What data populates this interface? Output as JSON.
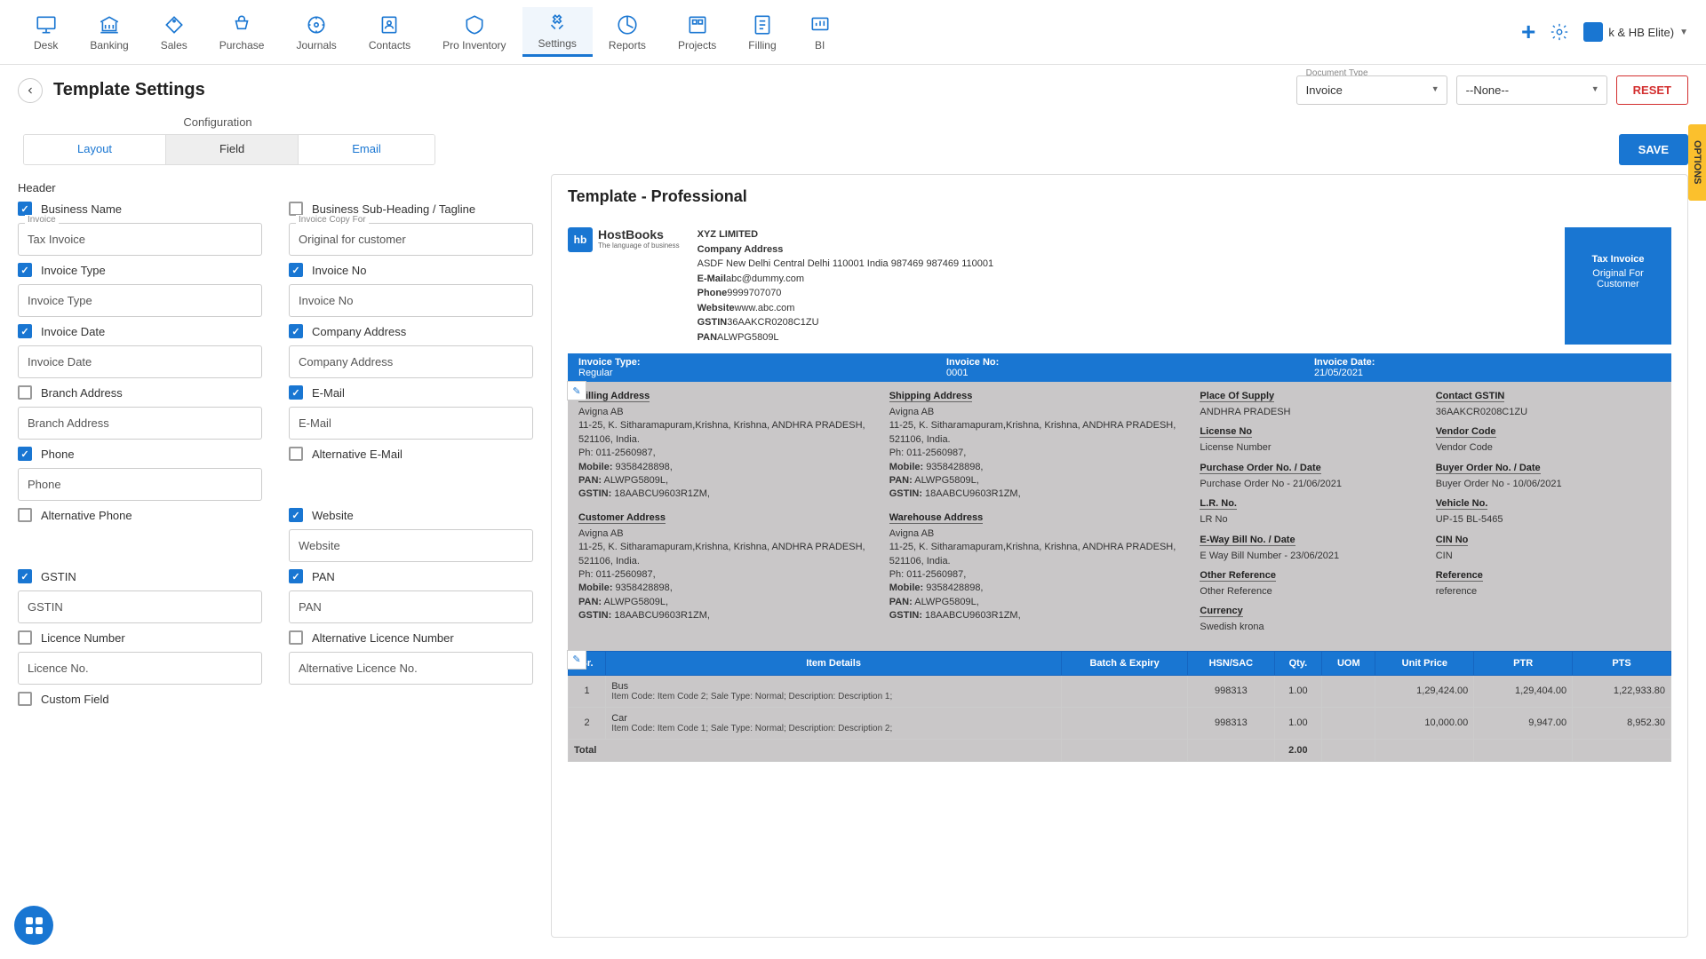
{
  "nav": [
    {
      "label": "Desk"
    },
    {
      "label": "Banking"
    },
    {
      "label": "Sales"
    },
    {
      "label": "Purchase"
    },
    {
      "label": "Journals"
    },
    {
      "label": "Contacts"
    },
    {
      "label": "Pro Inventory"
    },
    {
      "label": "Settings",
      "active": true
    },
    {
      "label": "Reports"
    },
    {
      "label": "Projects"
    },
    {
      "label": "Filling"
    },
    {
      "label": "BI"
    }
  ],
  "company": "k & HB Elite)",
  "pageTitle": "Template Settings",
  "docType": {
    "label": "Document Type",
    "value": "Invoice"
  },
  "secondSelect": "--None--",
  "resetBtn": "RESET",
  "saveBtn": "SAVE",
  "configLabel": "Configuration",
  "tabs": [
    "Layout",
    "Field",
    "Email"
  ],
  "optionsTab": "OPTIONS",
  "sectionHeader": "Header",
  "fields": [
    {
      "check": true,
      "label": "Business Name",
      "floatLabel": "Invoice",
      "value": "Tax Invoice"
    },
    {
      "check": false,
      "label": "Business Sub-Heading / Tagline",
      "floatLabel": "Invoice Copy For",
      "value": "Original for customer"
    },
    {
      "check": true,
      "label": "Invoice Type",
      "value": "Invoice Type"
    },
    {
      "check": true,
      "label": "Invoice No",
      "value": "Invoice No"
    },
    {
      "check": true,
      "label": "Invoice Date",
      "value": "Invoice Date"
    },
    {
      "check": true,
      "label": "Company Address",
      "value": "Company Address"
    },
    {
      "check": false,
      "label": "Branch Address",
      "value": "Branch Address"
    },
    {
      "check": true,
      "label": "E-Mail",
      "value": "E-Mail"
    },
    {
      "check": true,
      "label": "Phone",
      "value": "Phone"
    },
    {
      "check": false,
      "label": "Alternative E-Mail",
      "noInput": true
    },
    {
      "check": false,
      "label": "Alternative Phone",
      "noInput": true
    },
    {
      "check": true,
      "label": "Website",
      "value": "Website"
    },
    {
      "check": true,
      "label": "GSTIN",
      "value": "GSTIN"
    },
    {
      "check": true,
      "label": "PAN",
      "value": "PAN"
    },
    {
      "check": false,
      "label": "Licence Number",
      "value": "Licence No."
    },
    {
      "check": false,
      "label": "Alternative Licence Number",
      "value": "Alternative Licence No."
    },
    {
      "check": false,
      "label": "Custom Field",
      "noInput": true
    }
  ],
  "preview": {
    "title": "Template - Professional",
    "logo": {
      "name": "HostBooks",
      "sub": "The language of business"
    },
    "company": {
      "name": "XYZ LIMITED",
      "addrLabel": "Company Address",
      "addr": "ASDF New Delhi Central Delhi 110001 India 987469 987469 110001",
      "emailLabel": "E-Mail",
      "email": "abc@dummy.com",
      "phoneLabel": "Phone",
      "phone": "9999707070",
      "webLabel": "Website",
      "web": "www.abc.com",
      "gstinLabel": "GSTIN",
      "gstin": "36AAKCR0208C1ZU",
      "panLabel": "PAN",
      "pan": "ALWPG5809L"
    },
    "blueBox": {
      "title": "Tax Invoice",
      "sub": "Original For Customer"
    },
    "bar": {
      "c1l": "Invoice Type:",
      "c1v": "Regular",
      "c2l": "Invoice No:",
      "c2v": "0001",
      "c3l": "Invoice Date:",
      "c3v": "21/05/2021"
    },
    "addr": {
      "billing": {
        "title": "Billing Address",
        "name": "Avigna AB",
        "l1": "11-25, K. Sitharamapuram,Krishna, Krishna, ANDHRA PRADESH, 521106, India.",
        "ph": "Ph: 011-2560987,",
        "mob": "Mobile: 9358428898,",
        "pan": "PAN: ALWPG5809L,",
        "gst": "GSTIN: 18AABCU9603R1ZM,"
      },
      "shipping": {
        "title": "Shipping Address",
        "name": "Avigna AB",
        "l1": "11-25, K. Sitharamapuram,Krishna, Krishna, ANDHRA PRADESH, 521106, India.",
        "ph": "Ph: 011-2560987,",
        "mob": "Mobile: 9358428898,",
        "pan": "PAN: ALWPG5809L,",
        "gst": "GSTIN: 18AABCU9603R1ZM,"
      },
      "customer": {
        "title": "Customer Address",
        "name": "Avigna AB",
        "l1": "11-25, K. Sitharamapuram,Krishna, Krishna, ANDHRA PRADESH, 521106, India.",
        "ph": "Ph: 011-2560987,",
        "mob": "Mobile: 9358428898,",
        "pan": "PAN: ALWPG5809L,",
        "gst": "GSTIN: 18AABCU9603R1ZM,"
      },
      "warehouse": {
        "title": "Warehouse Address",
        "name": "Avigna AB",
        "l1": "11-25, K. Sitharamapuram,Krishna, Krishna, ANDHRA PRADESH, 521106, India.",
        "ph": "Ph: 011-2560987,",
        "mob": "Mobile: 9358428898,",
        "pan": "PAN: ALWPG5809L,",
        "gst": "GSTIN: 18AABCU9603R1ZM,"
      },
      "meta1": [
        {
          "h": "Place Of Supply",
          "v": "ANDHRA PRADESH"
        },
        {
          "h": "License No",
          "v": "License Number"
        },
        {
          "h": "Purchase Order No. / Date",
          "v": "Purchase Order No - 21/06/2021"
        },
        {
          "h": "L.R. No.",
          "v": "LR No"
        },
        {
          "h": "E-Way Bill No. / Date",
          "v": "E Way Bill Number - 23/06/2021"
        },
        {
          "h": "Other Reference",
          "v": "Other Reference"
        },
        {
          "h": "Currency",
          "v": "Swedish krona"
        }
      ],
      "meta2": [
        {
          "h": "Contact GSTIN",
          "v": "36AAKCR0208C1ZU"
        },
        {
          "h": "Vendor Code",
          "v": "Vendor Code"
        },
        {
          "h": "Buyer Order No. / Date",
          "v": "Buyer Order No - 10/06/2021"
        },
        {
          "h": "Vehicle No.",
          "v": "UP-15 BL-5465"
        },
        {
          "h": "CIN No",
          "v": "CIN"
        },
        {
          "h": "Reference",
          "v": "reference"
        }
      ]
    },
    "table": {
      "headers": [
        "Sr.",
        "Item Details",
        "Batch & Expiry",
        "HSN/SAC",
        "Qty.",
        "UOM",
        "Unit Price",
        "PTR",
        "PTS"
      ],
      "rows": [
        {
          "sr": "1",
          "name": "Bus",
          "sub": "Item Code: Item Code 2; Sale Type: Normal; Description: Description 1;",
          "batch": "",
          "hsn": "998313",
          "qty": "1.00",
          "uom": "",
          "price": "1,29,424.00",
          "ptr": "1,29,404.00",
          "pts": "1,22,933.80"
        },
        {
          "sr": "2",
          "name": "Car",
          "sub": "Item Code: Item Code 1; Sale Type: Normal; Description: Description 2;",
          "batch": "",
          "hsn": "998313",
          "qty": "1.00",
          "uom": "",
          "price": "10,000.00",
          "ptr": "9,947.00",
          "pts": "8,952.30"
        }
      ],
      "totalLabel": "Total",
      "totalQty": "2.00"
    }
  }
}
